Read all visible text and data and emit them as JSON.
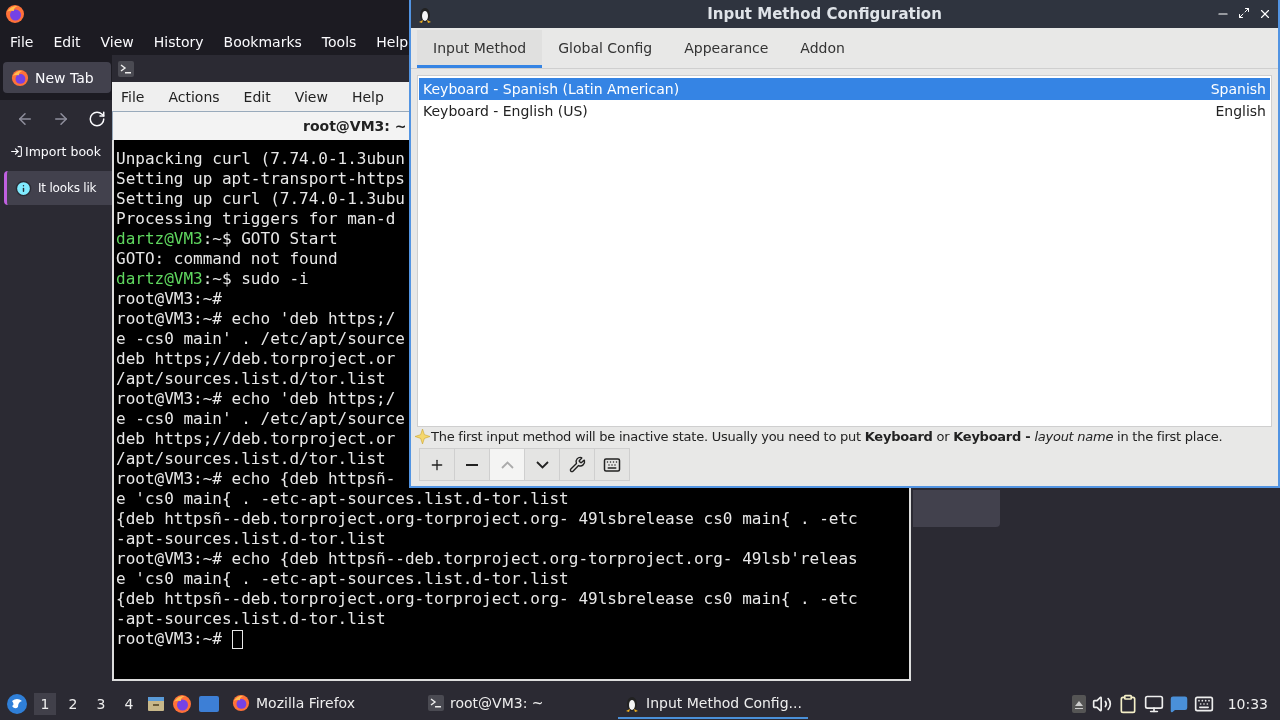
{
  "firefox": {
    "menu": [
      "File",
      "Edit",
      "View",
      "History",
      "Bookmarks",
      "Tools",
      "Help"
    ],
    "tab": "New Tab",
    "bookmark": "Import book",
    "notice": "It looks lik"
  },
  "terminal": {
    "menu": [
      "File",
      "Actions",
      "Edit",
      "View",
      "Help"
    ],
    "tab_title": "root@VM3: ~",
    "lines": [
      {
        "text": "Unpacking curl (7.74.0-1.3ubun"
      },
      {
        "text": "Setting up apt-transport-https"
      },
      {
        "text": "Setting up curl (7.74.0-1.3ubu"
      },
      {
        "text": "Processing triggers for man-d"
      },
      {
        "prompt": "dartz@VM3",
        "text": ":~$ GOTO Start"
      },
      {
        "text": "GOTO: command not found"
      },
      {
        "prompt": "dartz@VM3",
        "text": ":~$ sudo -i"
      },
      {
        "text": "root@VM3:~#"
      },
      {
        "text": "root@VM3:~# echo 'deb https;/"
      },
      {
        "text": "e -cs0 main' . /etc/apt/source"
      },
      {
        "text": "deb https;//deb.torproject.or"
      },
      {
        "text": "/apt/sources.list.d/tor.list"
      },
      {
        "text": "root@VM3:~# echo 'deb https;/"
      },
      {
        "text": "e -cs0 main' . /etc/apt/source"
      },
      {
        "text": "deb https;//deb.torproject.or"
      },
      {
        "text": "/apt/sources.list.d/tor.list"
      },
      {
        "text": "root@VM3:~# echo {deb httpsñ-"
      },
      {
        "text": "e 'cs0 main{ . -etc-apt-sources.list.d-tor.list"
      },
      {
        "text": "{deb httpsñ--deb.torproject.org-torproject.org- 49lsbrelease cs0 main{ . -etc"
      },
      {
        "text": "-apt-sources.list.d-tor.list"
      },
      {
        "text": "root@VM3:~# echo {deb httpsñ--deb.torproject.org-torproject.org- 49lsb'releas"
      },
      {
        "text": "e 'cs0 main{ . -etc-apt-sources.list.d-tor.list"
      },
      {
        "text": "{deb httpsñ--deb.torproject.org-torproject.org- 49lsbrelease cs0 main{ . -etc"
      },
      {
        "text": "-apt-sources.list.d-tor.list"
      },
      {
        "text": "root@VM3:~# ",
        "cursor": true
      }
    ]
  },
  "dialog": {
    "title": "Input Method Configuration",
    "tabs": [
      {
        "label": "Input Method",
        "selected": true
      },
      {
        "label": "Global Config",
        "selected": false
      },
      {
        "label": "Appearance",
        "selected": false
      },
      {
        "label": "Addon",
        "selected": false
      }
    ],
    "methods": [
      {
        "name": "Keyboard - Spanish (Latin American)",
        "language": "Spanish",
        "selected": true
      },
      {
        "name": "Keyboard - English (US)",
        "language": "English",
        "selected": false
      }
    ],
    "hint": "The first input method will be inactive state. Usually you need to put **Keyboard** or **Keyboard -** *layout name* in the first place.",
    "toolbar": [
      {
        "kind": "add",
        "disabled": false
      },
      {
        "kind": "remove",
        "disabled": false
      },
      {
        "kind": "up",
        "disabled": true
      },
      {
        "kind": "down",
        "disabled": false
      },
      {
        "kind": "configure",
        "disabled": false
      },
      {
        "kind": "keyboard",
        "disabled": false
      }
    ]
  },
  "taskbar": {
    "workspaces": [
      {
        "label": "1",
        "selected": true
      },
      {
        "label": "2",
        "selected": false
      },
      {
        "label": "3",
        "selected": false
      },
      {
        "label": "4",
        "selected": false
      }
    ],
    "tasks": [
      {
        "kind": "browser",
        "label": "Mozilla Firefox",
        "selected": false
      },
      {
        "kind": "terminal",
        "label": "root@VM3: ~",
        "selected": false
      },
      {
        "kind": "config",
        "label": "Input Method Config...",
        "selected": true
      }
    ],
    "clock": "10:33"
  }
}
